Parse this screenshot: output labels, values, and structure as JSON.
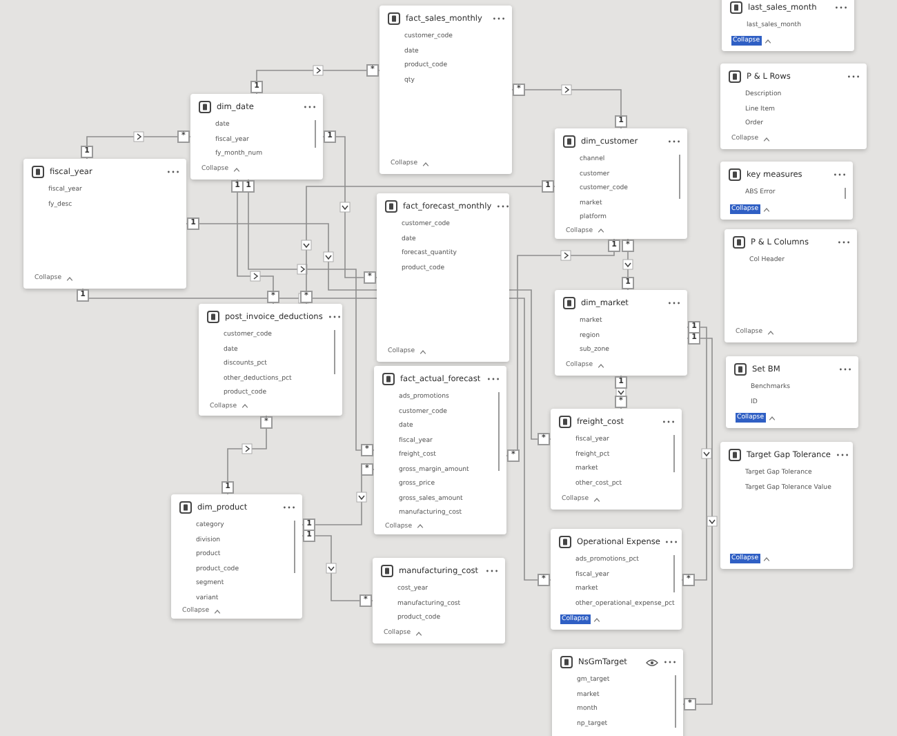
{
  "tables": [
    {
      "name": "fiscal_year",
      "fields": [
        "fiscal_year",
        "fy_desc"
      ],
      "collapse": "Collapse",
      "collapse_highlighted": false,
      "hidden_in_report": false
    },
    {
      "name": "dim_date",
      "fields": [
        "date",
        "fiscal_year",
        "fy_month_num"
      ],
      "collapse": "Collapse",
      "collapse_highlighted": false,
      "hidden_in_report": false
    },
    {
      "name": "fact_sales_monthly",
      "fields": [
        "customer_code",
        "date",
        "product_code",
        "qty"
      ],
      "collapse": "Collapse",
      "collapse_highlighted": false,
      "hidden_in_report": false
    },
    {
      "name": "fact_forecast_monthly",
      "fields": [
        "customer_code",
        "date",
        "forecast_quantity",
        "product_code"
      ],
      "collapse": "Collapse",
      "collapse_highlighted": false,
      "hidden_in_report": false
    },
    {
      "name": "dim_customer",
      "fields": [
        "channel",
        "customer",
        "customer_code",
        "market",
        "platform"
      ],
      "collapse": "Collapse",
      "collapse_highlighted": false,
      "hidden_in_report": false
    },
    {
      "name": "dim_market",
      "fields": [
        "market",
        "region",
        "sub_zone"
      ],
      "collapse": "Collapse",
      "collapse_highlighted": false,
      "hidden_in_report": false
    },
    {
      "name": "post_invoice_deductions",
      "fields": [
        "customer_code",
        "date",
        "discounts_pct",
        "other_deductions_pct",
        "product_code"
      ],
      "collapse": "Collapse",
      "collapse_highlighted": false,
      "hidden_in_report": false
    },
    {
      "name": "fact_actual_forecast",
      "fields": [
        "ads_promotions",
        "customer_code",
        "date",
        "fiscal_year",
        "freight_cost",
        "gross_margin_amount",
        "gross_price",
        "gross_sales_amount",
        "manufacturing_cost"
      ],
      "collapse": "Collapse",
      "collapse_highlighted": false,
      "hidden_in_report": false
    },
    {
      "name": "manufacturing_cost",
      "fields": [
        "cost_year",
        "manufacturing_cost",
        "product_code"
      ],
      "collapse": "Collapse",
      "collapse_highlighted": false,
      "hidden_in_report": false
    },
    {
      "name": "dim_product",
      "fields": [
        "category",
        "division",
        "product",
        "product_code",
        "segment",
        "variant"
      ],
      "collapse": "Collapse",
      "collapse_highlighted": false,
      "hidden_in_report": false
    },
    {
      "name": "freight_cost",
      "fields": [
        "fiscal_year",
        "freight_pct",
        "market",
        "other_cost_pct"
      ],
      "collapse": "Collapse",
      "collapse_highlighted": false,
      "hidden_in_report": false
    },
    {
      "name": "Operational Expense",
      "fields": [
        "ads_promotions_pct",
        "fiscal_year",
        "market",
        "other_operational_expense_pct"
      ],
      "collapse": "Collapse",
      "collapse_highlighted": true,
      "hidden_in_report": false
    },
    {
      "name": "NsGmTarget",
      "fields": [
        "gm_target",
        "market",
        "month",
        "np_target"
      ],
      "hidden_in_report": true
    },
    {
      "name": "last_sales_month",
      "fields": [
        "last_sales_month"
      ],
      "collapse": "Collapse",
      "collapse_highlighted": true,
      "hidden_in_report": false
    },
    {
      "name": "P & L Rows",
      "fields": [
        "Description",
        "Line Item",
        "Order"
      ],
      "collapse": "Collapse",
      "collapse_highlighted": false,
      "hidden_in_report": false
    },
    {
      "name": "key measures",
      "fields": [
        "ABS Error"
      ],
      "collapse": "Collapse",
      "collapse_highlighted": true,
      "hidden_in_report": false
    },
    {
      "name": "P & L Columns",
      "fields": [
        "Col Header"
      ],
      "collapse": "Collapse",
      "collapse_highlighted": false,
      "hidden_in_report": false
    },
    {
      "name": "Set BM",
      "fields": [
        "Benchmarks",
        "ID"
      ],
      "collapse": "Collapse",
      "collapse_highlighted": true,
      "hidden_in_report": false
    },
    {
      "name": "Target Gap Tolerance",
      "fields": [
        "Target Gap Tolerance",
        "Target Gap Tolerance Value"
      ],
      "collapse": "Collapse",
      "collapse_highlighted": true,
      "hidden_in_report": false
    }
  ],
  "relationships": [
    {
      "ends": [
        "1",
        "*"
      ]
    },
    {
      "ends": [
        "1",
        "*"
      ]
    },
    {
      "ends": [
        "1",
        "*"
      ]
    },
    {
      "ends": [
        "1",
        "*"
      ]
    },
    {
      "ends": [
        "1",
        "*"
      ]
    },
    {
      "ends": [
        "1",
        "*"
      ]
    },
    {
      "ends": [
        "1",
        "*"
      ]
    },
    {
      "ends": [
        "1",
        "*"
      ]
    },
    {
      "ends": [
        "1",
        "*"
      ]
    },
    {
      "ends": [
        "1",
        "*"
      ]
    },
    {
      "ends": [
        "*",
        "1"
      ]
    },
    {
      "ends": [
        "1",
        "*"
      ]
    },
    {
      "ends": [
        "1",
        "*"
      ]
    },
    {
      "ends": [
        "1",
        "*"
      ]
    },
    {
      "ends": [
        "1",
        "*"
      ]
    },
    {
      "ends": [
        "1",
        "*"
      ]
    },
    {
      "ends": [
        "1",
        "*"
      ]
    }
  ]
}
